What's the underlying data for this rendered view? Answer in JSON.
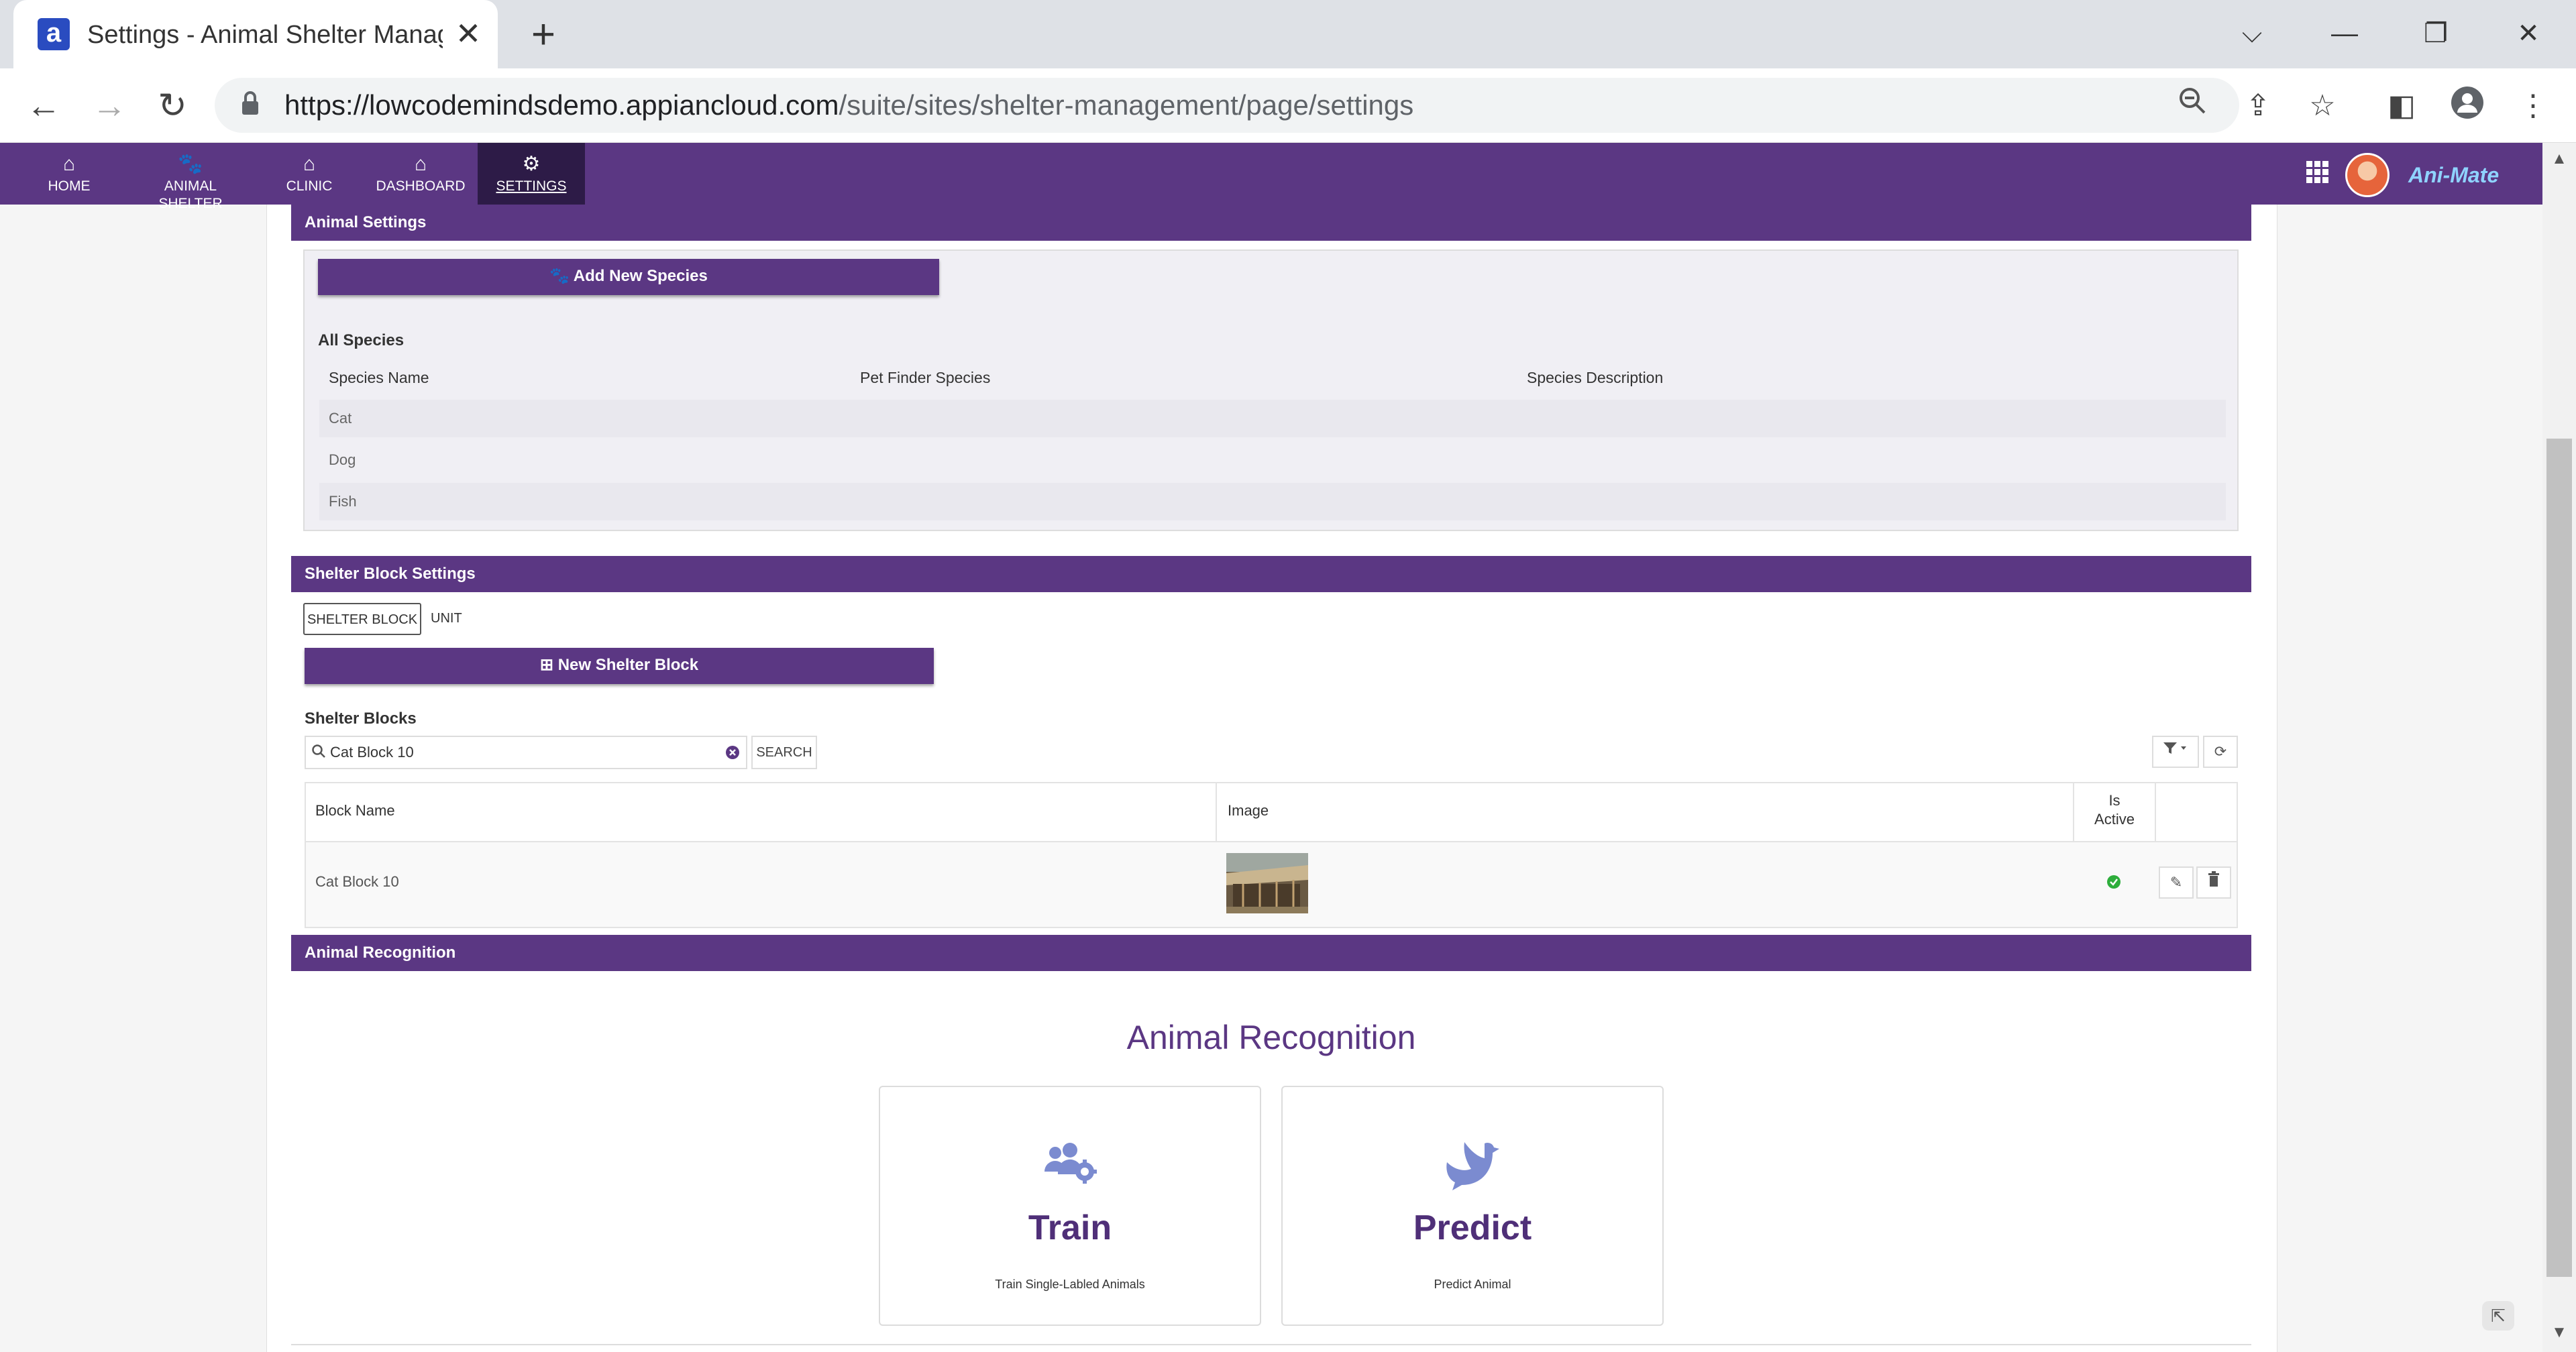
{
  "browser": {
    "tab_title": "Settings - Animal Shelter Manage",
    "favicon_letter": "a",
    "url_host": "https://lowcodemindsdemo.appiancloud.com",
    "url_path": "/suite/sites/shelter-management/page/settings"
  },
  "nav": {
    "items": [
      {
        "label": "HOME",
        "icon": "home-icon"
      },
      {
        "label": "ANIMAL SHELTER",
        "icon": "paw-icon"
      },
      {
        "label": "CLINIC",
        "icon": "home-icon"
      },
      {
        "label": "DASHBOARD",
        "icon": "home-icon"
      },
      {
        "label": "SETTINGS",
        "icon": "gear-icon",
        "active": true
      }
    ],
    "logo_text": "Ani-Mate"
  },
  "animal_settings": {
    "header": "Animal Settings",
    "add_button": "Add New Species",
    "list_title": "All Species",
    "columns": [
      "Species Name",
      "Pet Finder Species",
      "Species Description"
    ],
    "rows": [
      {
        "name": "Cat",
        "pet_finder": "",
        "description": ""
      },
      {
        "name": "Dog",
        "pet_finder": "",
        "description": ""
      },
      {
        "name": "Fish",
        "pet_finder": "",
        "description": ""
      }
    ]
  },
  "shelter_block_settings": {
    "header": "Shelter Block Settings",
    "tabs": [
      "SHELTER BLOCK",
      "UNIT"
    ],
    "new_button": "New Shelter Block",
    "grid_title": "Shelter Blocks",
    "search_value": "Cat Block 10",
    "search_button": "SEARCH",
    "columns": {
      "block_name": "Block Name",
      "image": "Image",
      "is_active_line1": "Is",
      "is_active_line2": "Active"
    },
    "rows": [
      {
        "block_name": "Cat Block 10",
        "is_active": true
      }
    ]
  },
  "animal_recognition": {
    "header": "Animal Recognition",
    "title": "Animal Recognition",
    "cards": [
      {
        "title": "Train",
        "subtitle": "Train Single-Labled Animals",
        "icon": "users-gear-icon"
      },
      {
        "title": "Predict",
        "subtitle": "Predict Animal",
        "icon": "dove-icon"
      }
    ]
  },
  "colors": {
    "brand_purple": "#5b3783",
    "nav_active": "#2d1b47",
    "card_icon": "#7b8bd0",
    "active_green": "#2eae3c"
  }
}
